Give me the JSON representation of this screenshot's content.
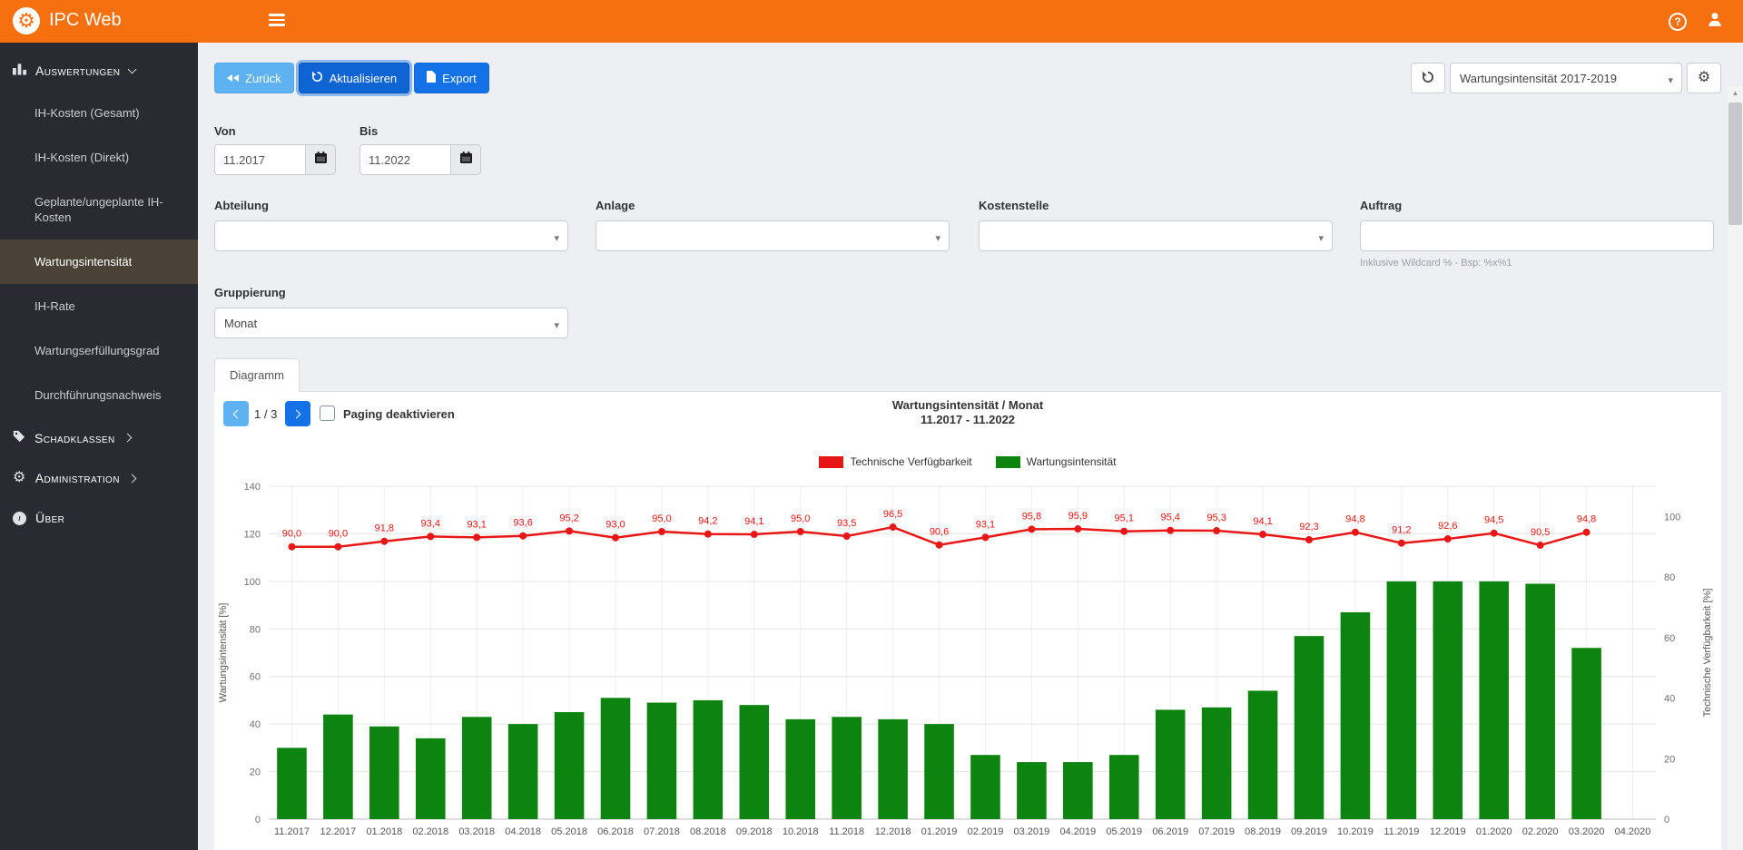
{
  "header": {
    "app_title": "IPC Web"
  },
  "icons": {
    "logo": "gear-icon",
    "menu": "hamburger-menu-icon",
    "help": "question-mark-circle-icon",
    "account": "user-icon",
    "back": "rewind-icon",
    "refresh": "refresh-icon",
    "export": "file-icon",
    "date": "calendar-icon",
    "settings": "gear-icon"
  },
  "colors": {
    "header_bar": "#f7700f",
    "sidebar_bg": "#2a2a33",
    "active_item_bg": "#4b4237",
    "primary_button": "#1372e8",
    "info_button": "#5fb2f2",
    "bar_series": "#0e8410",
    "line_series": "#e81717"
  },
  "sidebar": {
    "auswertungen": {
      "label": "Auswertungen",
      "items": [
        "IH-Kosten (Gesamt)",
        "IH-Kosten (Direkt)",
        "Geplante/ungeplante IH-Kosten",
        "Wartungsintensität",
        "IH-Rate",
        "Wartungserfüllungsgrad",
        "Durchführungsnachweis"
      ],
      "active_item": "Wartungsintensität"
    },
    "schadklassen": {
      "label": "Schadklassen"
    },
    "administration": {
      "label": "Administration"
    },
    "ueber": {
      "label": "Über"
    }
  },
  "toolbar": {
    "back_label": "Zurück",
    "refresh_label": "Aktualisieren",
    "export_label": "Export",
    "preset_value": "Wartungsintensität 2017-2019"
  },
  "filters": {
    "von_label": "Von",
    "von_value": "11.2017",
    "bis_label": "Bis",
    "bis_value": "11.2022",
    "abteilung_label": "Abteilung",
    "abteilung_value": "",
    "anlage_label": "Anlage",
    "anlage_value": "",
    "kostenstelle_label": "Kostenstelle",
    "kostenstelle_value": "",
    "auftrag_label": "Auftrag",
    "auftrag_value": "",
    "auftrag_hint": "Inklusive Wildcard % - Bsp: %x%1",
    "gruppierung_label": "Gruppierung",
    "gruppierung_value": "Monat"
  },
  "tabs": {
    "diagramm_label": "Diagramm"
  },
  "panel": {
    "page_indicator": "1 / 3",
    "paging_checkbox_label": "Paging deaktivieren"
  },
  "chart_data": {
    "type": "bar",
    "title": "Wartungsintensität / Monat",
    "subtitle": "11.2017 - 11.2022",
    "legend_position": "top",
    "grid": true,
    "categories": [
      "11.2017",
      "12.2017",
      "01.2018",
      "02.2018",
      "03.2018",
      "04.2018",
      "05.2018",
      "06.2018",
      "07.2018",
      "08.2018",
      "09.2018",
      "10.2018",
      "11.2018",
      "12.2018",
      "01.2019",
      "02.2019",
      "03.2019",
      "04.2019",
      "05.2019",
      "06.2019",
      "07.2019",
      "08.2019",
      "09.2019",
      "10.2019",
      "11.2019",
      "12.2019",
      "01.2020",
      "02.2020",
      "03.2020",
      "04.2020"
    ],
    "series": [
      {
        "name": "Technische Verfügbarkeit",
        "type": "line",
        "axis": "right",
        "color": "#e81717",
        "values": [
          90.0,
          90.0,
          91.8,
          93.4,
          93.1,
          93.6,
          95.2,
          93.0,
          95.0,
          94.2,
          94.1,
          95.0,
          93.5,
          96.5,
          90.6,
          93.1,
          95.8,
          95.9,
          95.1,
          95.4,
          95.3,
          94.1,
          92.3,
          94.8,
          91.2,
          92.6,
          94.5,
          90.5,
          94.8,
          null
        ]
      },
      {
        "name": "Wartungsintensität",
        "type": "bar",
        "axis": "left",
        "color": "#0e8410",
        "values": [
          30,
          44,
          39,
          34,
          43,
          40,
          45,
          51,
          49,
          50,
          48,
          42,
          43,
          42,
          40,
          27,
          24,
          24,
          27,
          46,
          47,
          54,
          77,
          87,
          100,
          100,
          100,
          99,
          72,
          null
        ]
      }
    ],
    "left_axis": {
      "label": "Wartungsintensität [%]",
      "min": 0,
      "max": 140,
      "ticks": [
        0,
        20,
        40,
        60,
        80,
        100,
        120,
        140
      ]
    },
    "right_axis": {
      "label": "Technische Verfügbarkeit [%]",
      "min": 0,
      "max": 100,
      "ticks": [
        0,
        20,
        40,
        60,
        80,
        100
      ],
      "display_max": 110
    }
  }
}
